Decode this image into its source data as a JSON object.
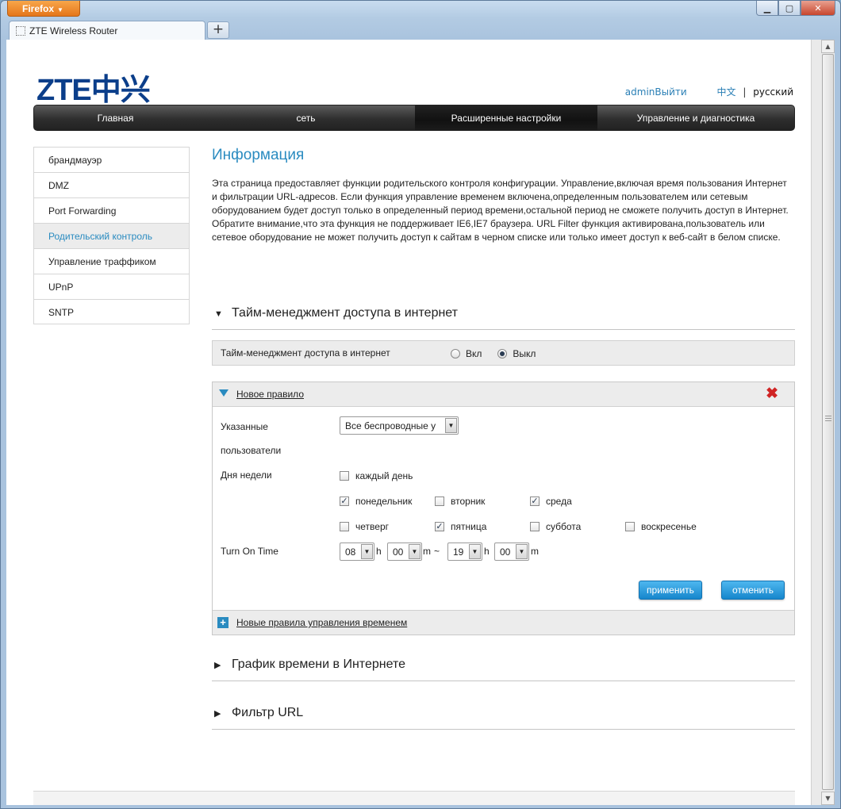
{
  "browser": {
    "app_button": "Firefox",
    "tab_title": "ZTE Wireless Router",
    "new_tab": "+",
    "controls": {
      "minimize": "▁",
      "maximize": "▢",
      "close": "✕"
    }
  },
  "header": {
    "logo": "ZTE中兴",
    "user": "adminВыйти",
    "lang_zh": "中文",
    "lang_sep": "|",
    "lang_ru": "русский"
  },
  "nav": {
    "items": [
      {
        "label": "Главная"
      },
      {
        "label": "сеть"
      },
      {
        "label": "Расширенные настройки"
      },
      {
        "label": "Управление и диагностика"
      }
    ],
    "active_index": 2
  },
  "sidebar": {
    "items": [
      {
        "label": "брандмауэр"
      },
      {
        "label": "DMZ"
      },
      {
        "label": "Port Forwarding"
      },
      {
        "label": "Родительский контроль"
      },
      {
        "label": "Управление траффиком"
      },
      {
        "label": "UPnP"
      },
      {
        "label": "SNTP"
      }
    ],
    "active_index": 3
  },
  "main": {
    "title": "Информация",
    "description": "Эта страница предоставляет функции родительского контроля конфигурации. Управление,включая время пользования Интернет и фильтрации URL-адресов. Если функция управление временем включена,определенным пользователем или сетевым оборудованием будет доступ только в определенный период времени,остальной период не сможете получить доступ в Интернет. Обратите внимание,что эта функция не поддерживает IE6,IE7 браузера. URL Filter функция активирована,пользователь или сетевое оборудование не может получить доступ к сайтам в черном списке или только имеет доступ к веб-сайт в белом списке."
  },
  "time_access": {
    "section_title": "Тайм-менеджмент доступа в интернет",
    "row_label": "Тайм-менеджмент доступа в интернет",
    "on_label": "Вкл",
    "off_label": "Выкл",
    "selected": "off"
  },
  "rule": {
    "title": "Новое правило",
    "users_label_1": "Указанные",
    "users_label_2": "пользователи",
    "users_value": "Все беспроводные у",
    "days_label": "Дня недели",
    "days": [
      {
        "label": "каждый день",
        "checked": false
      },
      {
        "label": "понедельник",
        "checked": true
      },
      {
        "label": "вторник",
        "checked": false
      },
      {
        "label": "среда",
        "checked": true
      },
      {
        "label": "четверг",
        "checked": false
      },
      {
        "label": "пятница",
        "checked": true
      },
      {
        "label": "суббота",
        "checked": false
      },
      {
        "label": "воскресенье",
        "checked": false
      }
    ],
    "time_label": "Turn On Time",
    "start_hour": "08",
    "start_min": "00",
    "end_hour": "19",
    "end_min": "00",
    "unit_h": "h",
    "unit_m": "m",
    "range_sep": "~",
    "apply_label": "применить",
    "cancel_label": "отменить",
    "add_rule_label": "Новые правила управления временем"
  },
  "sections": {
    "schedule_title": "График времени в Интернете",
    "url_filter_title": "Фильтр URL"
  },
  "colors": {
    "accent": "#2a8bc0",
    "nav_bg": "#2e2e2e",
    "button_blue": "#1e95da",
    "delete_red": "#d02424"
  }
}
